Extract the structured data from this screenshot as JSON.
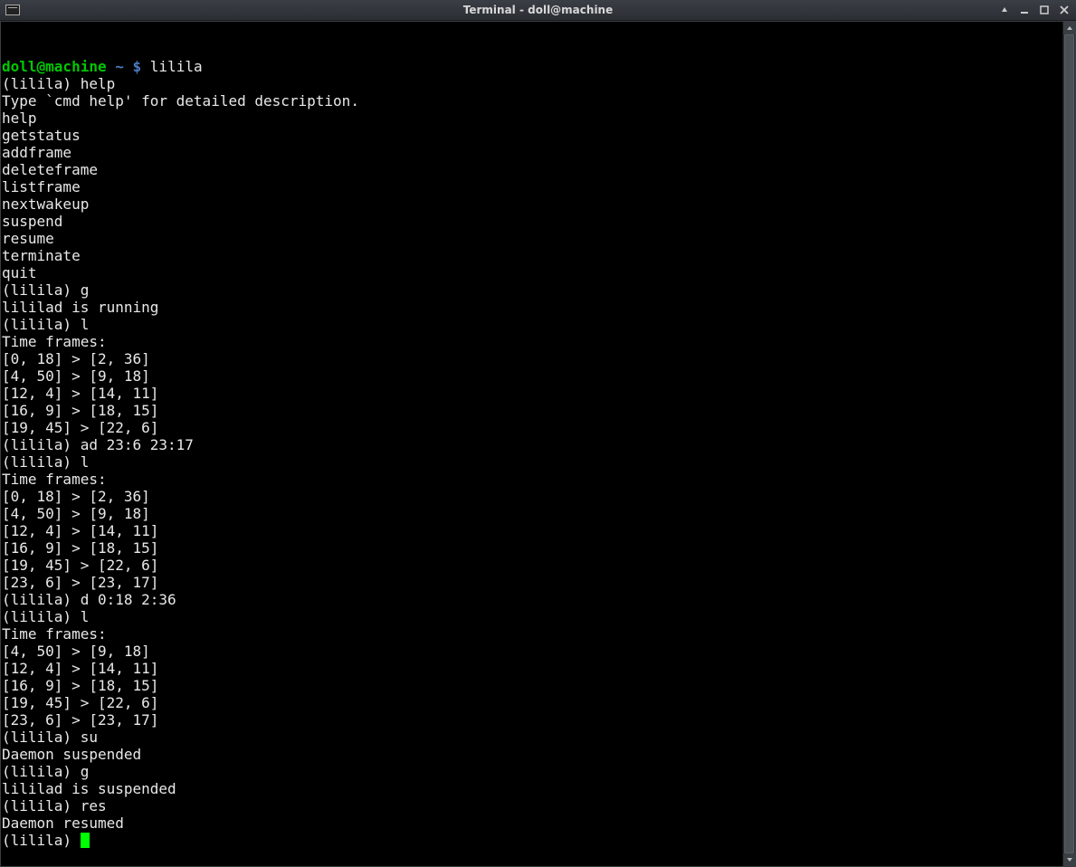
{
  "window": {
    "title": "Terminal - doll@machine"
  },
  "prompt": {
    "userhost": "doll@machine",
    "path": "~",
    "symbol": "$",
    "command": "lilila"
  },
  "session": {
    "l1": "(lilila) help",
    "l2": "Type `cmd help' for detailed description.",
    "l3": "",
    "l4": "help",
    "l5": "getstatus",
    "l6": "addframe",
    "l7": "deleteframe",
    "l8": "listframe",
    "l9": "nextwakeup",
    "l10": "suspend",
    "l11": "resume",
    "l12": "terminate",
    "l13": "quit",
    "l14": "(lilila) g",
    "l15": "lililad is running",
    "l16": "(lilila) l",
    "l17": "Time frames:",
    "l18": "[0, 18] > [2, 36]",
    "l19": "[4, 50] > [9, 18]",
    "l20": "[12, 4] > [14, 11]",
    "l21": "[16, 9] > [18, 15]",
    "l22": "[19, 45] > [22, 6]",
    "l23": "(lilila) ad 23:6 23:17",
    "l24": "(lilila) l",
    "l25": "Time frames:",
    "l26": "[0, 18] > [2, 36]",
    "l27": "[4, 50] > [9, 18]",
    "l28": "[12, 4] > [14, 11]",
    "l29": "[16, 9] > [18, 15]",
    "l30": "[19, 45] > [22, 6]",
    "l31": "[23, 6] > [23, 17]",
    "l32": "(lilila) d 0:18 2:36",
    "l33": "(lilila) l",
    "l34": "Time frames:",
    "l35": "[4, 50] > [9, 18]",
    "l36": "[12, 4] > [14, 11]",
    "l37": "[16, 9] > [18, 15]",
    "l38": "[19, 45] > [22, 6]",
    "l39": "[23, 6] > [23, 17]",
    "l40": "(lilila) su",
    "l41": "Daemon suspended",
    "l42": "(lilila) g",
    "l43": "lililad is suspended",
    "l44": "(lilila) res",
    "l45": "Daemon resumed",
    "l46": "(lilila) "
  }
}
